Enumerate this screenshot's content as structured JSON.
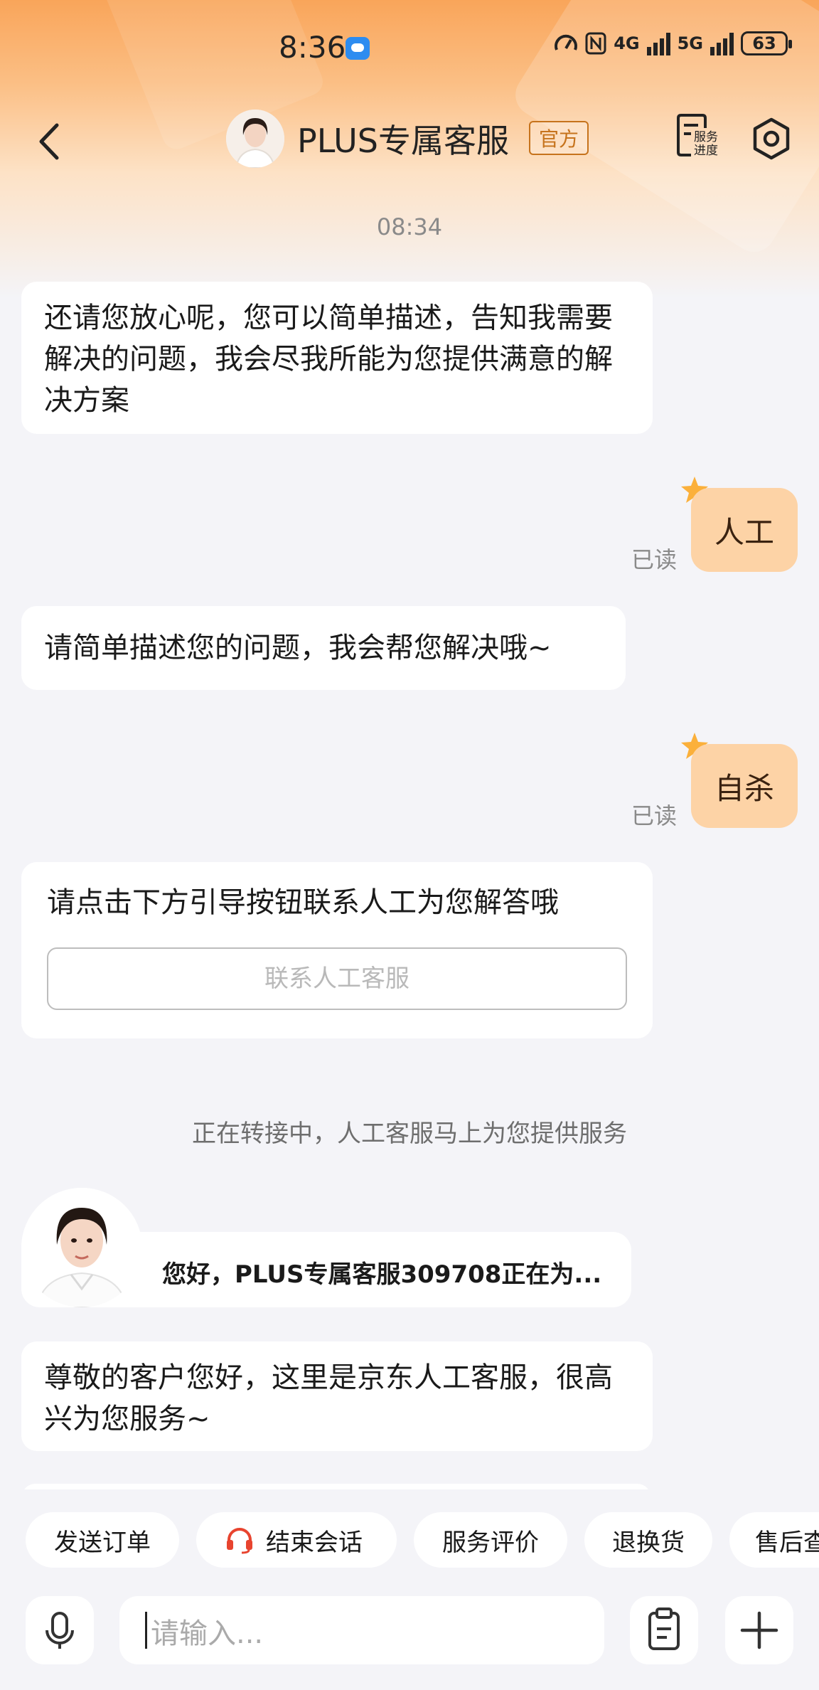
{
  "status_bar": {
    "time": "8:36",
    "net1": "4G",
    "net2": "5G",
    "battery": "63"
  },
  "header": {
    "title": "PLUS专属客服",
    "badge": "官方",
    "service_progress_label": "服务进度"
  },
  "timestamp": "08:34",
  "messages": {
    "m1": "还请您放心呢，您可以简单描述，告知我需要解决的问题，我会尽我所能为您提供满意的解决方案",
    "u1": "人工",
    "u1_read": "已读",
    "m2": "请简单描述您的问题，我会帮您解决哦~",
    "u2": "自杀",
    "u2_read": "已读",
    "m3": "请点击下方引导按钮联系人工为您解答哦",
    "m3_button": "联系人工客服",
    "system": "正在转接中，人工客服马上为您提供服务",
    "agent_greeting": "您好，PLUS专属客服309708正在为...",
    "m4": "尊敬的客户您好，这里是京东人工客服，很高兴为您服务~"
  },
  "quick_actions": [
    "发送订单",
    "结束会话",
    "服务评价",
    "退换货",
    "售后查"
  ],
  "input": {
    "placeholder": "请输入..."
  },
  "colors": {
    "accent": "#f9a55a",
    "user_bubble": "#fdd3a6",
    "end_session_icon": "#e8442f"
  },
  "icons": [
    "back-icon",
    "service-progress-icon",
    "settings-icon",
    "headset-icon",
    "mic-icon",
    "emoji-icon",
    "clipboard-icon",
    "plus-icon",
    "star-icon"
  ]
}
